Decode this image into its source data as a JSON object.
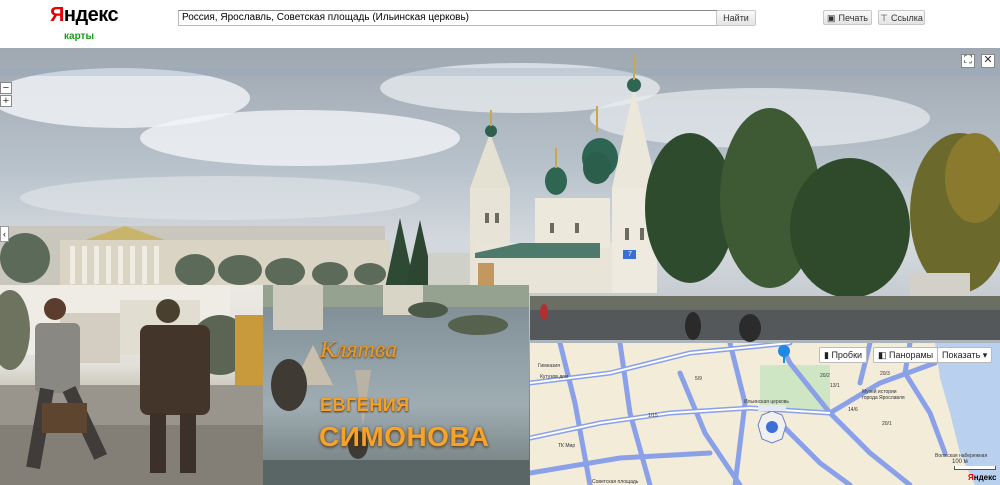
{
  "header": {
    "logo_first": "Я",
    "logo_rest": "ндекс",
    "logo_sub": "карты",
    "search_value": "Россия, Ярославль, Советская площадь (Ильинская церковь)",
    "find_label": "Найти",
    "print_label": "Печать",
    "link_label": "Ссылка",
    "print_icon": "printer-icon",
    "link_icon": "pin-icon"
  },
  "panorama": {
    "zoom_out": "−",
    "zoom_in": "+",
    "fullscreen": "⛶",
    "close": "✕",
    "arrow": "‹",
    "marker_label": "7"
  },
  "film": {
    "title": "Клятва",
    "name_line1": "ЕВГЕНИЯ",
    "name_line2": "СИМОНОВА"
  },
  "map": {
    "traffic_label": "Пробки",
    "panorama_label": "Панорамы",
    "show_label": "Показать",
    "labels": [
      "Гимназия",
      "Кутузов дом",
      "Ильинская церковь",
      "Музей истории",
      "города Ярославля",
      "ТК Мир",
      "Советская площадь",
      "Волжская набережная",
      "5/9",
      "1/15",
      "20/2",
      "13/1",
      "14/6",
      "20/3",
      "20/1"
    ],
    "scale": "100 м",
    "logo_first": "Я",
    "logo_rest": "ндекс"
  },
  "colors": {
    "brand_red": "#e60000",
    "map_road": "#8aa0e8",
    "map_bg": "#f2ecd8",
    "map_water": "#b9d1ee",
    "film_text": "#f3a12b"
  }
}
